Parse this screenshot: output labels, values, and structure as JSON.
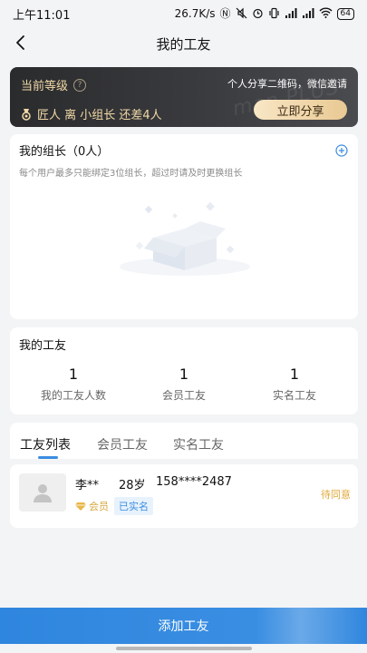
{
  "status_bar": {
    "time": "上午11:01",
    "network_speed": "26.7K/s",
    "battery": "64",
    "icons": [
      "nfc-icon",
      "mute-icon",
      "alarm-icon",
      "vibrate-icon",
      "hd-signal-icon",
      "signal-icon",
      "wifi-icon",
      "battery-icon"
    ]
  },
  "nav": {
    "title": "我的工友",
    "back_icon": "chevron-left-icon"
  },
  "level_card": {
    "title": "当前等级",
    "help_icon": "question-circle-icon",
    "share_hint": "个人分享二维码，微信邀请",
    "status": "匠人 离 小组长 还差4人",
    "medal_icon": "medal-icon",
    "share_button": "立即分享",
    "watermark": "man PLUS",
    "colors": {
      "background": "#2a2b2d",
      "gold_text": "#f1d9a7",
      "button": "#e9c993"
    }
  },
  "leader": {
    "title": "我的组长（0人）",
    "description": "每个用户最多只能绑定3位组长，超过时请及时更换组长",
    "add_icon": "plus-circle-icon",
    "empty_icon": "empty-box-icon"
  },
  "workmate": {
    "title": "我的工友",
    "stats": [
      {
        "value": "1",
        "label": "我的工友人数"
      },
      {
        "value": "1",
        "label": "会员工友"
      },
      {
        "value": "1",
        "label": "实名工友"
      }
    ]
  },
  "tabs": {
    "items": [
      "工友列表",
      "会员工友",
      "实名工友"
    ],
    "active_index": 0
  },
  "list": [
    {
      "name": "李**",
      "age": "28岁",
      "phone": "158****2487",
      "member_badge": "会员",
      "verified_badge": "已实名",
      "status": "待同意"
    }
  ],
  "bottom_button": {
    "label": "添加工友",
    "color": "#2f86de"
  }
}
